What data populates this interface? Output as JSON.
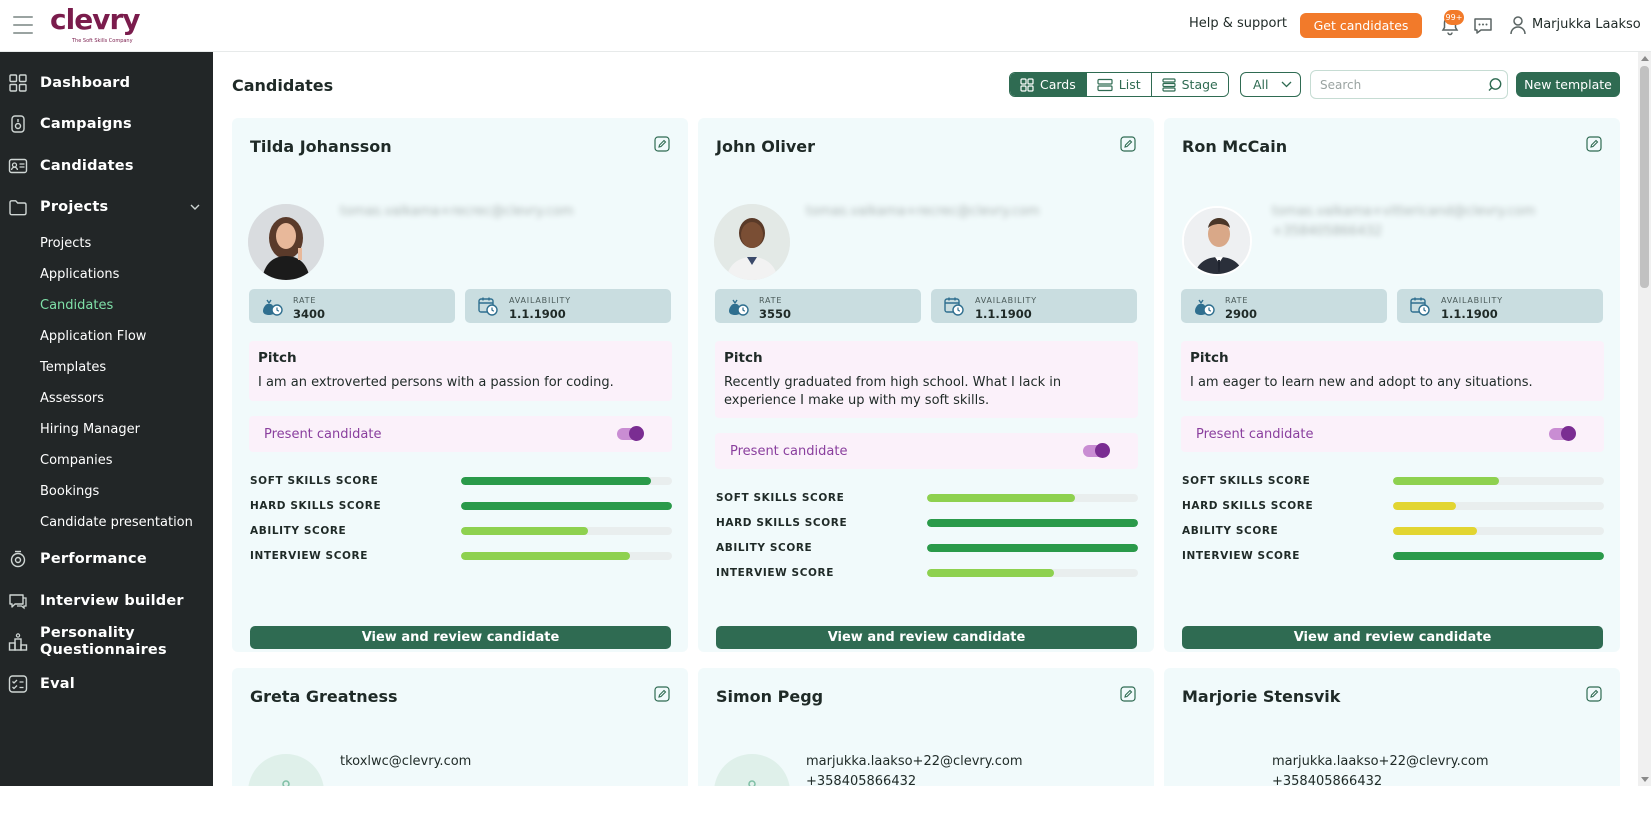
{
  "header": {
    "logo_text": "clevry",
    "logo_tagline": "The Soft Skills Company",
    "help_label": "Help & support",
    "get_candidates_label": "Get candidates",
    "notifications_badge": "99+",
    "user_name": "Marjukka Laakso",
    "icons": [
      "hamburger-menu-icon",
      "bell-icon",
      "chat-icon",
      "user-icon"
    ]
  },
  "sidebar": {
    "main_items": [
      {
        "label": "Dashboard",
        "icon": "grid-icon"
      },
      {
        "label": "Campaigns",
        "icon": "campaign-icon"
      },
      {
        "label": "Candidates",
        "icon": "id-card-icon"
      },
      {
        "label": "Projects",
        "icon": "folder-icon",
        "expanded": true
      },
      {
        "label": "Performance",
        "icon": "performance-icon"
      },
      {
        "label": "Interview builder",
        "icon": "chat-bubble-icon"
      },
      {
        "label": "Personality Questionnaires",
        "icon": "podium-icon"
      },
      {
        "label": "Eval",
        "icon": "checklist-icon"
      }
    ],
    "project_subitems": [
      {
        "label": "Projects",
        "active": false
      },
      {
        "label": "Applications",
        "active": false
      },
      {
        "label": "Candidates",
        "active": true
      },
      {
        "label": "Application Flow",
        "active": false
      },
      {
        "label": "Templates",
        "active": false
      },
      {
        "label": "Assessors",
        "active": false
      },
      {
        "label": "Hiring Manager",
        "active": false
      },
      {
        "label": "Companies",
        "active": false
      },
      {
        "label": "Bookings",
        "active": false
      },
      {
        "label": "Candidate presentation",
        "active": false
      }
    ],
    "active_color": "#7fe0a8"
  },
  "main": {
    "title": "Candidates",
    "view_modes": [
      {
        "label": "Cards",
        "active": true
      },
      {
        "label": "List",
        "active": false
      },
      {
        "label": "Stage",
        "active": false
      }
    ],
    "filter_value": "All",
    "search_placeholder": "Search",
    "new_template_label": "New template"
  },
  "labels": {
    "rate": "RATE",
    "availability": "AVAILABILITY",
    "pitch": "Pitch",
    "present_candidate": "Present candidate",
    "view_review": "View and review candidate",
    "score_names": [
      "SOFT SKILLS SCORE",
      "HARD SKILLS SCORE",
      "ABILITY SCORE",
      "INTERVIEW SCORE"
    ]
  },
  "candidates": [
    {
      "name": "Tilda Johansson",
      "email": "tomas.valkama+recrec@clevry.com",
      "phone": "",
      "rate": "3400",
      "availability": "1.1.1900",
      "pitch": "I am an extroverted persons with a passion for coding.",
      "present_enabled": true,
      "scores": [
        0.9,
        1.0,
        0.6,
        0.8
      ],
      "score_colors": [
        "#2a9a4a",
        "#2a9a4a",
        "#8ed14f",
        "#8ed14f"
      ]
    },
    {
      "name": "John Oliver",
      "email": "tomas.valkama+recrec@clevry.com",
      "phone": "",
      "rate": "3550",
      "availability": "1.1.1900",
      "pitch": "Recently graduated from high school. What I lack in experience I make up with my soft skills.",
      "present_enabled": true,
      "scores": [
        0.7,
        1.0,
        1.0,
        0.6
      ],
      "score_colors": [
        "#8ed14f",
        "#2a9a4a",
        "#2a9a4a",
        "#8ed14f"
      ]
    },
    {
      "name": "Ron McCain",
      "email": "tomas.valkama+vittericand@clevry.com",
      "phone": "+358405866432",
      "rate": "2900",
      "availability": "1.1.1900",
      "pitch": "I am eager to learn new and adopt to any situations.",
      "present_enabled": true,
      "scores": [
        0.5,
        0.3,
        0.4,
        1.0
      ],
      "score_colors": [
        "#8ed14f",
        "#e2d531",
        "#e2d531",
        "#2a9a4a"
      ]
    },
    {
      "name": "Greta Greatness",
      "email": "tkoxlwc@clevry.com",
      "phone": ""
    },
    {
      "name": "Simon Pegg",
      "email": "marjukka.laakso+22@clevry.com",
      "phone": "+358405866432"
    },
    {
      "name": "Marjorie Stensvik",
      "email": "marjukka.laakso+22@clevry.com",
      "phone": "+358405866432"
    }
  ],
  "colors": {
    "brand": "#7a1c4c",
    "primary_green": "#2f6b52",
    "accent_orange": "#f27a2a",
    "sidebar_bg": "#222627",
    "card_bg": "#f1fafb"
  }
}
